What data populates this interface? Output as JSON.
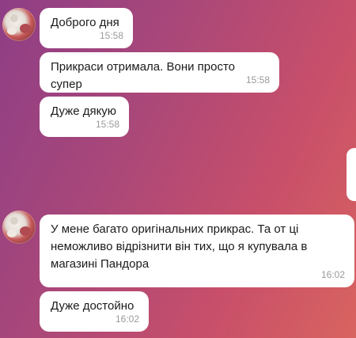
{
  "messages": [
    {
      "text": "Доброго дня",
      "time": "15:58"
    },
    {
      "text": "Прикраси отримала. Вони просто супер",
      "time": "15:58"
    },
    {
      "text": "Дуже дякую",
      "time": "15:58"
    },
    {
      "text": "У мене багато оригінальних прикрас. Та от ці\nнеможливо відрізнити він тих, що я купувала в\nмагазині Пандора",
      "time": "16:02"
    },
    {
      "text": "Дуже достойно",
      "time": "16:02"
    }
  ],
  "colors": {
    "bg_start": "#8e3e86",
    "bg_end": "#d8645f",
    "bubble": "#ffffff",
    "timestamp": "#9a9a9a"
  }
}
